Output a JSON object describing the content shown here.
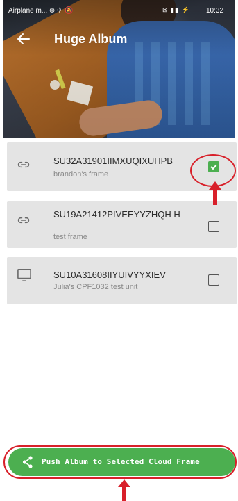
{
  "status_bar": {
    "left_text": "Airplane m... ⊕ ✈ 🔕",
    "icons": "⊠ ▮▮ ⚡",
    "time": "10:32"
  },
  "header": {
    "title": "Huge Album",
    "back_icon": "arrow-left-icon"
  },
  "frames": [
    {
      "id": "SU32A31901IIMXUQIXUHPB",
      "name": "brandon's frame",
      "icon": "link-icon",
      "checked": true
    },
    {
      "id": "SU19A21412PIVEEYYZHQH H",
      "name": "test frame",
      "icon": "link-icon",
      "checked": false
    },
    {
      "id": "SU10A31608IIYUIVYYXIEV",
      "name": "Julia's CPF1032 test unit",
      "icon": "monitor-icon",
      "checked": false
    }
  ],
  "push_button": {
    "label": "Push Album to Selected Cloud Frame",
    "icon": "share-icon"
  },
  "colors": {
    "accent_green": "#4caf50",
    "annotation_red": "#d8202a",
    "card_bg": "#e4e4e4"
  }
}
